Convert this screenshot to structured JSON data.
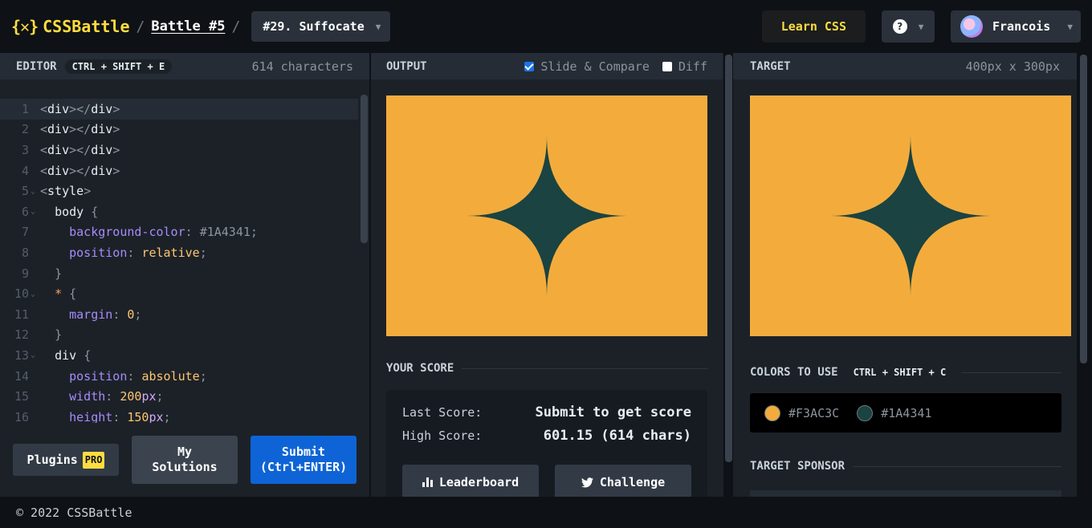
{
  "header": {
    "logo_text": "CSSBattle",
    "logo_mark": "{✕}",
    "breadcrumb_sep": "/",
    "battle_link": "Battle #5",
    "challenge_select": "#29. Suffocate",
    "learn_label": "Learn CSS",
    "help_glyph": "?",
    "user_name": "Francois"
  },
  "editor": {
    "title": "EDITOR",
    "shortcut": "CTRL + SHIFT + E",
    "char_count": "614 characters",
    "lines": [
      {
        "n": "1",
        "fold": "",
        "text": "<div></div>"
      },
      {
        "n": "2",
        "fold": "",
        "text": "<div></div>"
      },
      {
        "n": "3",
        "fold": "",
        "text": "<div></div>"
      },
      {
        "n": "4",
        "fold": "",
        "text": "<div></div>"
      },
      {
        "n": "5",
        "fold": "v",
        "text": "<style>"
      },
      {
        "n": "6",
        "fold": "v",
        "text": "  body {"
      },
      {
        "n": "7",
        "fold": "",
        "text": "    background-color: #1A4341;"
      },
      {
        "n": "8",
        "fold": "",
        "text": "    position: relative;"
      },
      {
        "n": "9",
        "fold": "",
        "text": "  }"
      },
      {
        "n": "10",
        "fold": "v",
        "text": "  * {"
      },
      {
        "n": "11",
        "fold": "",
        "text": "    margin: 0;"
      },
      {
        "n": "12",
        "fold": "",
        "text": "  }"
      },
      {
        "n": "13",
        "fold": "v",
        "text": "  div {"
      },
      {
        "n": "14",
        "fold": "",
        "text": "    position: absolute;"
      },
      {
        "n": "15",
        "fold": "",
        "text": "    width: 200px;"
      },
      {
        "n": "16",
        "fold": "",
        "text": "    height: 150px;"
      }
    ],
    "plugins_label": "Plugins",
    "pro_badge": "PRO",
    "solutions_label_1": "My",
    "solutions_label_2": "Solutions",
    "submit_label_1": "Submit",
    "submit_label_2": "(Ctrl+ENTER)"
  },
  "output": {
    "title": "OUTPUT",
    "slide_compare_label": "Slide & Compare",
    "slide_compare_checked": true,
    "diff_label": "Diff",
    "diff_checked": false,
    "score_title": "YOUR SCORE",
    "last_score_label": "Last Score:",
    "last_score_value": "Submit to get score",
    "high_score_label": "High Score:",
    "high_score_value": "601.15 (614 chars)",
    "leaderboard_label": "Leaderboard",
    "challenge_label": "Challenge"
  },
  "target": {
    "title": "TARGET",
    "dimensions": "400px x 300px",
    "colors_title": "COLORS TO USE",
    "colors_shortcut": "CTRL + SHIFT + C",
    "colors": [
      {
        "hex": "#F3AC3C",
        "label": "#F3AC3C"
      },
      {
        "hex": "#1A4341",
        "label": "#1A4341"
      }
    ],
    "sponsor_title": "TARGET SPONSOR"
  },
  "palette": {
    "background": "#F3AC3C",
    "star": "#1A4341",
    "accent_yellow": "#FFDD40",
    "submit_blue": "#0E64D6"
  },
  "footer": {
    "copyright": "© 2022 CSSBattle"
  }
}
